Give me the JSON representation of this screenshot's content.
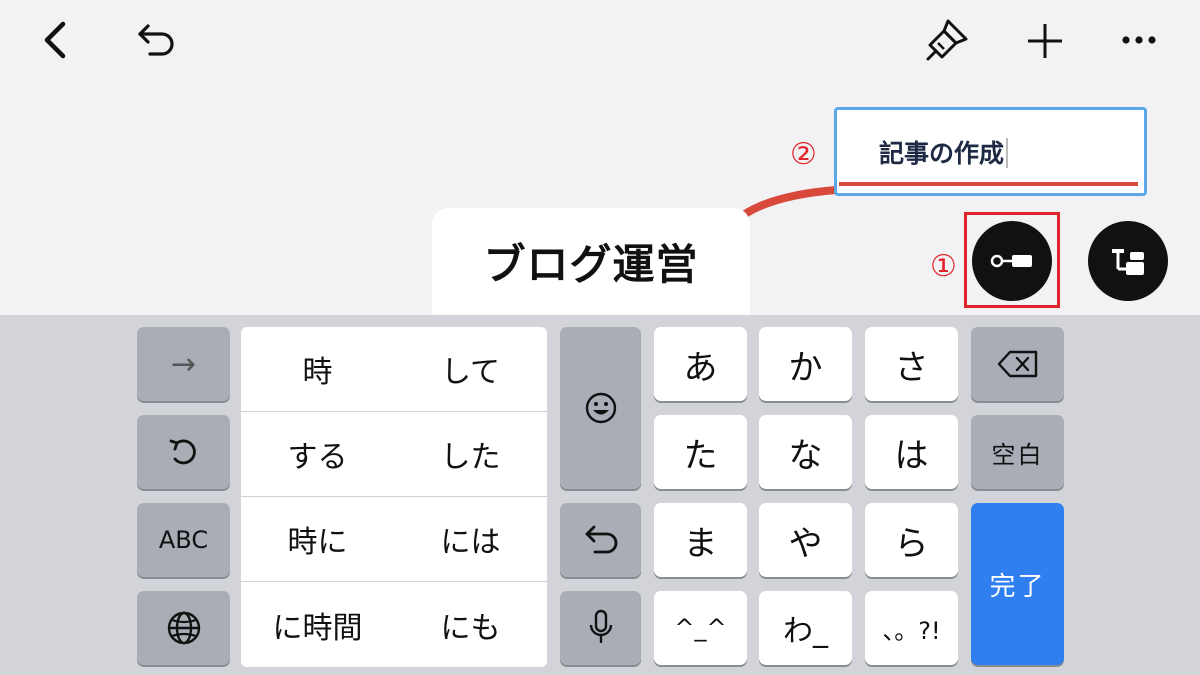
{
  "toolbar": {
    "back": "back-icon",
    "undo": "undo-icon",
    "style": "paintbrush-icon",
    "add": "plus-icon",
    "more": "more-icon"
  },
  "mindmap": {
    "root_label": "ブログ運営",
    "child_label": "記事の作成",
    "annotation_1": "①",
    "annotation_2": "②",
    "colors": {
      "connector": "#d8493c",
      "selection_border": "#5aa9e6",
      "annotation": "#e0242b"
    },
    "actions": [
      "add-sibling-icon",
      "add-child-icon"
    ]
  },
  "keyboard": {
    "left_keys": {
      "arrow": "→",
      "abc": "ABC"
    },
    "candidates": [
      [
        "時",
        "して"
      ],
      [
        "する",
        "した"
      ],
      [
        "時に",
        "には"
      ],
      [
        "に時間",
        "にも"
      ]
    ],
    "kana": [
      [
        "あ",
        "か",
        "さ"
      ],
      [
        "た",
        "な",
        "は"
      ],
      [
        "ま",
        "や",
        "ら"
      ],
      [
        "^_^",
        "わ_",
        "、。?!"
      ]
    ],
    "space_label": "空白",
    "done_label": "完了",
    "accent_color": "#2f7ff1"
  }
}
